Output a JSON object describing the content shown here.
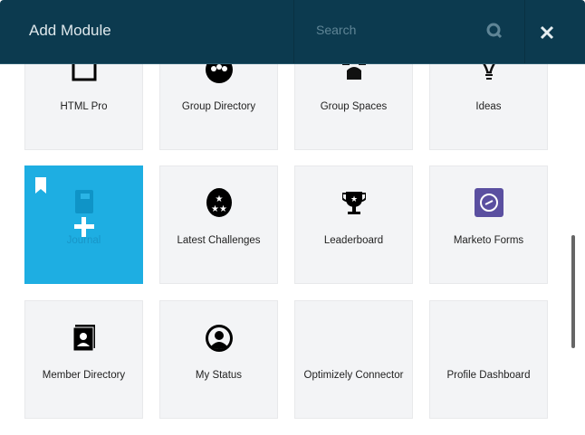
{
  "header": {
    "title": "Add Module",
    "search_placeholder": "Search"
  },
  "modules": [
    {
      "label": "HTML Pro",
      "icon": "html-code-icon"
    },
    {
      "label": "Group Directory",
      "icon": "group-icon"
    },
    {
      "label": "Group Spaces",
      "icon": "people-icon"
    },
    {
      "label": "Ideas",
      "icon": "lightbulb-icon"
    },
    {
      "label": "Journal",
      "icon": "journal-icon",
      "selected": true
    },
    {
      "label": "Latest Challenges",
      "icon": "stars-icon"
    },
    {
      "label": "Leaderboard",
      "icon": "trophy-icon"
    },
    {
      "label": "Marketo Forms",
      "icon": "marketo-icon"
    },
    {
      "label": "Member Directory",
      "icon": "member-directory-icon"
    },
    {
      "label": "My Status",
      "icon": "user-circle-icon"
    },
    {
      "label": "Optimizely Connector",
      "icon": "optimizely-icon"
    },
    {
      "label": "Profile Dashboard",
      "icon": "dashboard-icon"
    }
  ],
  "colors": {
    "header": "#0c3a4f",
    "selected": "#1eaee2",
    "marketo": "#5a4fa0"
  }
}
